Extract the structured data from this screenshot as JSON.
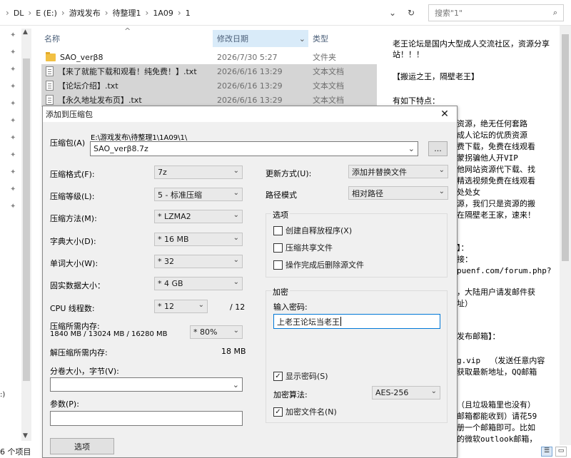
{
  "address": {
    "crumbs": [
      "DL",
      "E (E:)",
      "游戏发布",
      "待整理1",
      "1A09",
      "1"
    ],
    "search_placeholder": "搜索\"1\""
  },
  "list": {
    "col_name": "名称",
    "col_date": "修改日期",
    "col_type": "类型",
    "rows": [
      {
        "name": "SAO_verβ8",
        "date": "2026/7/30 5:27",
        "type": "文件夹",
        "icon": "folder-icon"
      },
      {
        "name": "【来了就能下载和观看！纯免费！】.txt",
        "date": "2026/6/16 13:29",
        "type": "文本文档",
        "icon": "text-file-icon"
      },
      {
        "name": "【论坛介绍】.txt",
        "date": "2026/6/16 13:29",
        "type": "文本文档",
        "icon": "text-file-icon"
      },
      {
        "name": "【永久地址发布页】.txt",
        "date": "2026/6/16 13:29",
        "type": "文本文档",
        "icon": "text-file-icon"
      }
    ]
  },
  "nav_label": ":)",
  "status": {
    "count": "6 个项目"
  },
  "preview": {
    "lines": [
      "老王论坛是国内大型成人交流社区，资源分享站！！！",
      "【搬运之王，隔壁老王】",
      "有如下特点：",
      "资源，绝无任何套路",
      "成人论坛的优质资源",
      "费下载，免费在线观看",
      "蒙拐骗他人开VIP",
      "他网站资源代下载、找",
      "精选视频免费在线观看",
      "处处女",
      "源，我们只是资源的搬",
      "在隔壁老王家，速来！",
      "】：",
      "接：",
      "puenf.com/forum.php?",
      "，大陆用户请发邮件获",
      "址）",
      "发布邮箱】：",
      "g.vip  （发送任意内容",
      "获取最新地址，QQ邮箱",
      "（且垃圾箱里也没有）",
      "邮箱都能收到）请花59",
      "册一个邮箱即可。比如",
      "的微软outlook邮箱，"
    ]
  },
  "dialog": {
    "title": "添加到压缩包",
    "archive_label": "压缩包(A)",
    "archive_path": "E:\\游戏发布\\待整理1\\1A09\\1\\",
    "archive_name": "SAO_verβ8.7z",
    "browse": "...",
    "format_label": "压缩格式(F):",
    "format_value": "7z",
    "level_label": "压缩等级(L):",
    "level_value": "5 - 标准压缩",
    "method_label": "压缩方法(M):",
    "method_value": "* LZMA2",
    "dict_label": "字典大小(D):",
    "dict_value": "* 16 MB",
    "word_label": "单词大小(W):",
    "word_value": "* 32",
    "solid_label": "固实数据大小：",
    "solid_value": "* 4 GB",
    "cpu_label": "CPU 线程数:",
    "cpu_value": "* 12",
    "cpu_total": "/ 12",
    "mem_label": "压缩所需内存:",
    "mem_detail": "1840 MB / 13024 MB / 16280 MB",
    "mem_value": "* 80%",
    "decomp_label": "解压缩所需内存:",
    "decomp_value": "18 MB",
    "split_label": "分卷大小，字节(V):",
    "params_label": "参数(P):",
    "options_button": "选项",
    "update_label": "更新方式(U):",
    "update_value": "添加并替换文件",
    "path_label": "路径模式",
    "path_value": "相对路径",
    "options_title": "选项",
    "opt_sfx": "创建自释放程序(X)",
    "opt_shared": "压缩共享文件",
    "opt_delete": "操作完成后删除源文件",
    "enc_title": "加密",
    "pwd_label": "输入密码:",
    "pwd_value": "上老王论坛当老王",
    "show_pwd": "显示密码(S)",
    "enc_method_label": "加密算法:",
    "enc_method_value": "AES-256",
    "enc_names": "加密文件名(N)"
  }
}
